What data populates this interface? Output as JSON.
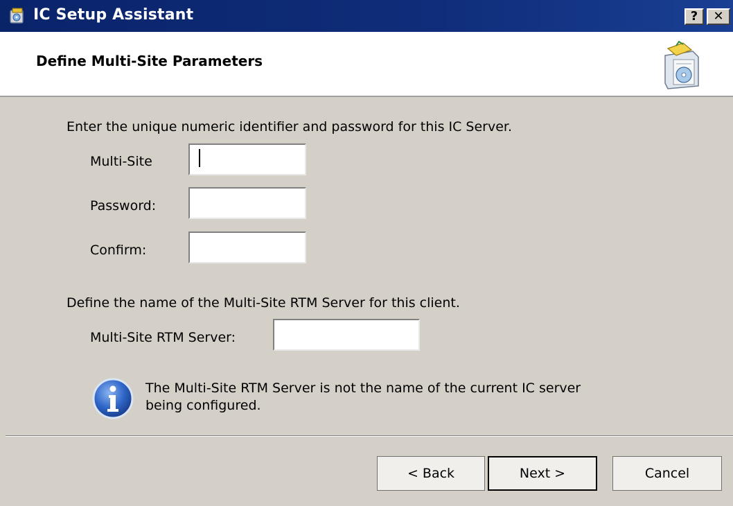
{
  "window": {
    "title": "IC Setup Assistant",
    "help_label": "?",
    "close_label": "✕"
  },
  "header": {
    "title": "Define Multi-Site Parameters"
  },
  "identity": {
    "instruction": "Enter the unique numeric identifier and password for this IC Server.",
    "multisite_label": "Multi-Site",
    "multisite_value": "",
    "password_label": "Password:",
    "password_value": "",
    "confirm_label": "Confirm:",
    "confirm_value": ""
  },
  "rtm": {
    "instruction": "Define the name of the Multi-Site RTM Server for this client.",
    "server_label": "Multi-Site RTM Server:",
    "server_value": ""
  },
  "info": {
    "icon": "info-icon",
    "message": "The Multi-Site RTM Server is not the name of the current IC server being configured."
  },
  "buttons": {
    "back": "< Back",
    "next": "Next >",
    "cancel": "Cancel"
  },
  "colors": {
    "titlebar": "#0a246a",
    "dialog_bg": "#d4d0c8",
    "header_bg": "#ffffff"
  }
}
